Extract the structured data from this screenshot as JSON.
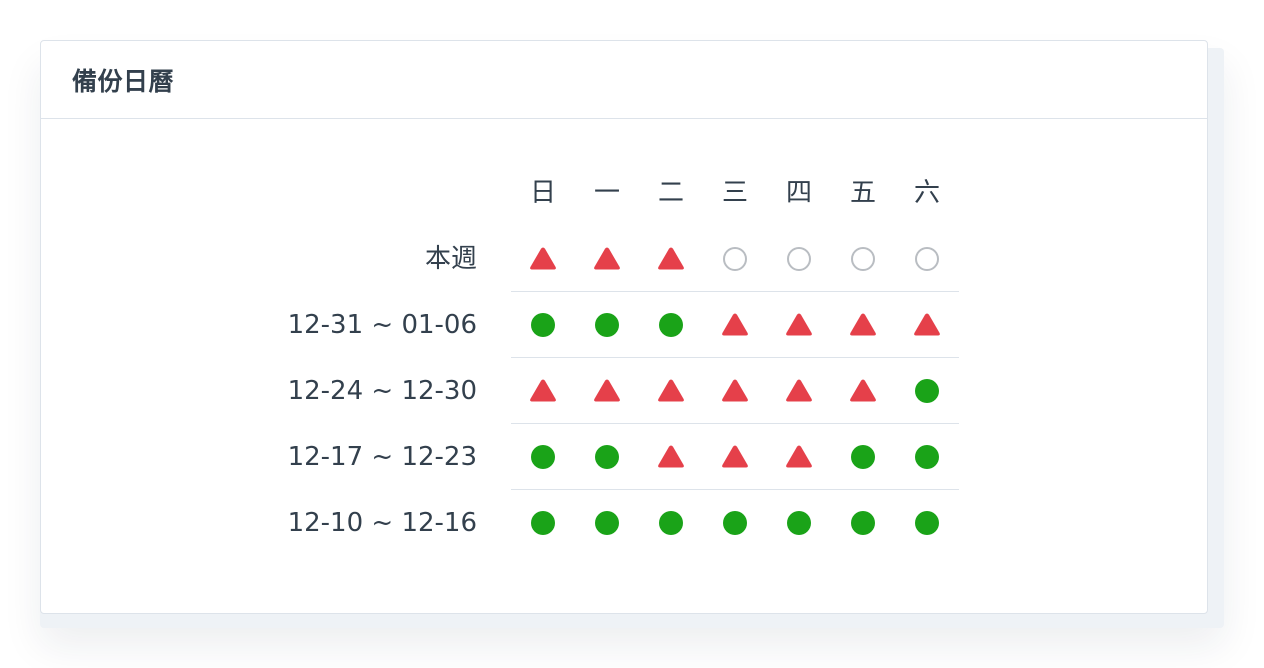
{
  "card": {
    "title": "備份日曆"
  },
  "calendar": {
    "weekdays": [
      "日",
      "一",
      "二",
      "三",
      "四",
      "五",
      "六"
    ],
    "legend_colors": {
      "success": "#1aa318",
      "warning": "#e5404a",
      "empty": "#b9bdc2"
    },
    "rows": [
      {
        "label": "本週",
        "status": [
          "warning",
          "warning",
          "warning",
          "empty",
          "empty",
          "empty",
          "empty"
        ]
      },
      {
        "label": "12-31 ~ 01-06",
        "status": [
          "success",
          "success",
          "success",
          "warning",
          "warning",
          "warning",
          "warning"
        ]
      },
      {
        "label": "12-24 ~ 12-30",
        "status": [
          "warning",
          "warning",
          "warning",
          "warning",
          "warning",
          "warning",
          "success"
        ]
      },
      {
        "label": "12-17 ~ 12-23",
        "status": [
          "success",
          "success",
          "warning",
          "warning",
          "warning",
          "success",
          "success"
        ]
      },
      {
        "label": "12-10 ~ 12-16",
        "status": [
          "success",
          "success",
          "success",
          "success",
          "success",
          "success",
          "success"
        ]
      }
    ]
  }
}
